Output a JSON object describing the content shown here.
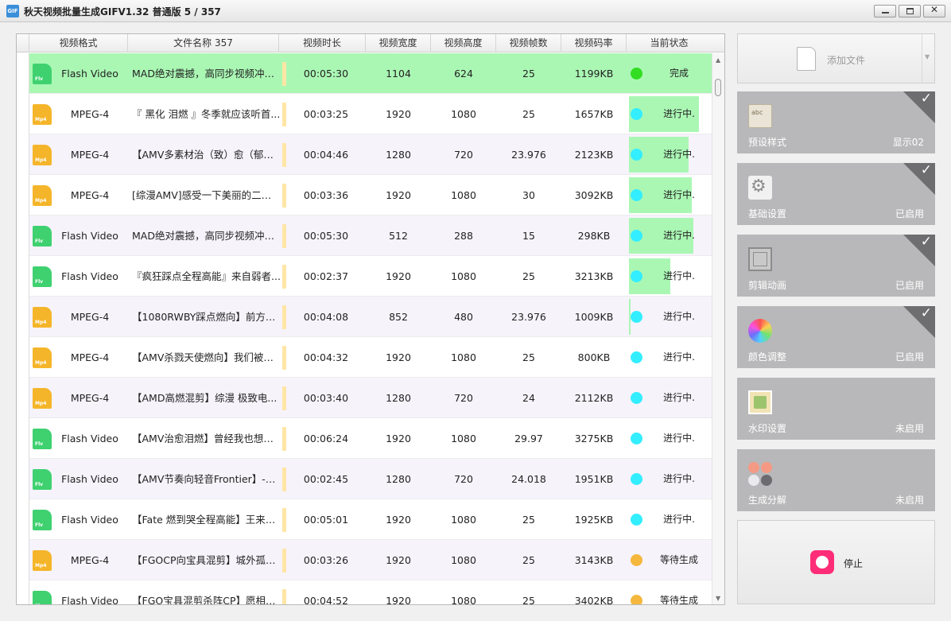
{
  "window": {
    "title": "秋天视频批量生成GIFV1.32 普通版 5 / 357",
    "icon_text": "GIF"
  },
  "table": {
    "columns": [
      "视频格式",
      "文件名称 357",
      "视频时长",
      "视频宽度",
      "视频高度",
      "视频帧数",
      "视频码率",
      "当前状态"
    ],
    "rows": [
      {
        "type": "flv",
        "format": "Flash Video",
        "name": "MAD绝对震撼，高同步视频冲击...",
        "duration": "00:05:30",
        "width": "1104",
        "height": "624",
        "fps": "25",
        "bitrate": "1199KB",
        "status": "完成",
        "dot": "#33dd22",
        "progress": 100
      },
      {
        "type": "mp4",
        "format": "MPEG-4",
        "name": "『 黑化  泪燃 』冬季就应该听首...",
        "duration": "00:03:25",
        "width": "1920",
        "height": "1080",
        "fps": "25",
        "bitrate": "1657KB",
        "status": "进行中.",
        "dot": "#33eeff",
        "progress": 85
      },
      {
        "type": "mp4",
        "format": "MPEG-4",
        "name": "【AMV多素材治（致）愈（郁）...",
        "duration": "00:04:46",
        "width": "1280",
        "height": "720",
        "fps": "23.976",
        "bitrate": "2123KB",
        "status": "进行中.",
        "dot": "#33eeff",
        "progress": 72
      },
      {
        "type": "mp4",
        "format": "MPEG-4",
        "name": "[综漫AMV]感受一下美丽的二次...",
        "duration": "00:03:36",
        "width": "1920",
        "height": "1080",
        "fps": "30",
        "bitrate": "3092KB",
        "status": "进行中.",
        "dot": "#33eeff",
        "progress": 76
      },
      {
        "type": "flv",
        "format": "Flash Video",
        "name": "MAD绝对震撼，高同步视频冲击...",
        "duration": "00:05:30",
        "width": "512",
        "height": "288",
        "fps": "15",
        "bitrate": "298KB",
        "status": "进行中.",
        "dot": "#33eeff",
        "progress": 78
      },
      {
        "type": "flv",
        "format": "Flash Video",
        "name": "『疯狂踩点全程高能』来自弱者...",
        "duration": "00:02:37",
        "width": "1920",
        "height": "1080",
        "fps": "25",
        "bitrate": "3213KB",
        "status": "进行中.",
        "dot": "#33eeff",
        "progress": 50
      },
      {
        "type": "mp4",
        "format": "MPEG-4",
        "name": "【1080RWBY踩点燃向】前方高...",
        "duration": "00:04:08",
        "width": "852",
        "height": "480",
        "fps": "23.976",
        "bitrate": "1009KB",
        "status": "进行中.",
        "dot": "#33eeff",
        "progress": 2
      },
      {
        "type": "mp4",
        "format": "MPEG-4",
        "name": "【AMV杀戮天使燃向】我们被生...",
        "duration": "00:04:32",
        "width": "1920",
        "height": "1080",
        "fps": "25",
        "bitrate": "800KB",
        "status": "进行中.",
        "dot": "#33eeff",
        "progress": 0
      },
      {
        "type": "mp4",
        "format": "MPEG-4",
        "name": "【AMD高燃混剪】综漫    极致电...",
        "duration": "00:03:40",
        "width": "1280",
        "height": "720",
        "fps": "24",
        "bitrate": "2112KB",
        "status": "进行中.",
        "dot": "#33eeff",
        "progress": 0
      },
      {
        "type": "flv",
        "format": "Flash Video",
        "name": "【AMV治愈泪燃】曾经我也想过...",
        "duration": "00:06:24",
        "width": "1920",
        "height": "1080",
        "fps": "29.97",
        "bitrate": "3275KB",
        "status": "进行中.",
        "dot": "#33eeff",
        "progress": 0
      },
      {
        "type": "flv",
        "format": "Flash Video",
        "name": "【AMV节奏向轻音Frontier】-一...",
        "duration": "00:02:45",
        "width": "1280",
        "height": "720",
        "fps": "24.018",
        "bitrate": "1951KB",
        "status": "进行中.",
        "dot": "#33eeff",
        "progress": 0
      },
      {
        "type": "flv",
        "format": "Flash Video",
        "name": "【Fate 燃到哭全程高能】王来承...",
        "duration": "00:05:01",
        "width": "1920",
        "height": "1080",
        "fps": "25",
        "bitrate": "1925KB",
        "status": "进行中.",
        "dot": "#33eeff",
        "progress": 0
      },
      {
        "type": "mp4",
        "format": "MPEG-4",
        "name": "【FGOCP向宝具混剪】城外孤身...",
        "duration": "00:03:26",
        "width": "1920",
        "height": "1080",
        "fps": "25",
        "bitrate": "3143KB",
        "status": "等待生成",
        "dot": "#f5b83d",
        "progress": 0
      },
      {
        "type": "flv",
        "format": "Flash Video",
        "name": "【FGO宝具混剪杀阵CP】愿相遇...",
        "duration": "00:04:52",
        "width": "1920",
        "height": "1080",
        "fps": "25",
        "bitrate": "3402KB",
        "status": "等待生成",
        "dot": "#f5b83d",
        "progress": 0
      }
    ]
  },
  "side": {
    "add_file": "添加文件",
    "cards": [
      {
        "label": "预设样式",
        "status": "显示02",
        "checked": true,
        "icon": "preset-icon"
      },
      {
        "label": "基础设置",
        "status": "已启用",
        "checked": true,
        "icon": "gear-icon"
      },
      {
        "label": "剪辑动画",
        "status": "已启用",
        "checked": true,
        "icon": "frame-icon"
      },
      {
        "label": "颜色调整",
        "status": "已启用",
        "checked": true,
        "icon": "color-wheel-icon"
      },
      {
        "label": "水印设置",
        "status": "未启用",
        "checked": false,
        "icon": "image-icon"
      },
      {
        "label": "生成分解",
        "status": "未启用",
        "checked": false,
        "icon": "dots-icon"
      }
    ],
    "stop": "停止"
  },
  "colors": {
    "done_row": "#aaf7b4",
    "progress": "#aaf7b4",
    "stop": "#ff2d78",
    "card": "#b8b8ba"
  }
}
